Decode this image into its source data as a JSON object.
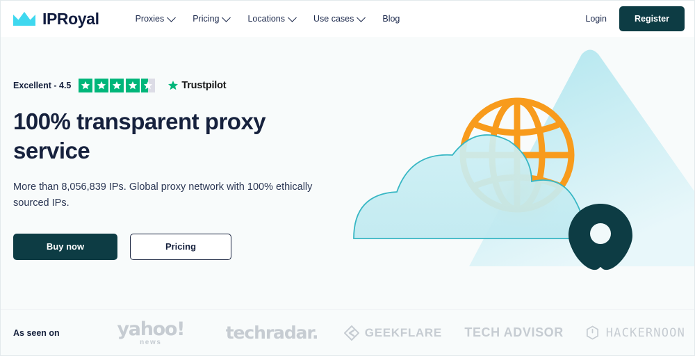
{
  "brand": {
    "name": "IPRoyal",
    "logo_icon": "crown-icon",
    "logo_color": "#3fd8ef",
    "text_color": "#111c3f"
  },
  "nav": {
    "items": [
      {
        "label": "Proxies",
        "has_dropdown": true,
        "icon": "chevron-down-icon"
      },
      {
        "label": "Pricing",
        "has_dropdown": true,
        "icon": "chevron-down-icon"
      },
      {
        "label": "Locations",
        "has_dropdown": true,
        "icon": "chevron-down-icon"
      },
      {
        "label": "Use cases",
        "has_dropdown": true,
        "icon": "chevron-down-icon"
      },
      {
        "label": "Blog",
        "has_dropdown": false,
        "icon": ""
      }
    ],
    "login_label": "Login",
    "register_label": "Register",
    "register_bg": "#0d3c44",
    "register_text_color": "#ffffff"
  },
  "hero": {
    "rating": {
      "text": "Excellent - 4.5",
      "score": "4.5",
      "stars_total": 5,
      "stars_filled": 4,
      "stars_half": 1,
      "star_color": "#00b67a",
      "star_empty_color": "#dcdce6",
      "provider": "Trustpilot",
      "provider_icon": "trustpilot-star-icon"
    },
    "headline": "100% transparent proxy service",
    "subhead": "More than 8,056,839 IPs. Global proxy network with 100% ethically sourced IPs.",
    "ip_count": "8,056,839",
    "primary_cta": "Buy now",
    "secondary_cta": "Pricing",
    "illustration": {
      "mountain_icon": "mountain-shape",
      "mountain_color": "#bfeaf0",
      "globe_icon": "globe-icon",
      "globe_color": "#f89b1c",
      "cloud_icon": "cloud-icon",
      "cloud_fill": "#c7eef3",
      "cloud_stroke": "#38b7c4",
      "pin_icon": "map-pin-icon",
      "pin_color": "#0d3c44"
    }
  },
  "press": {
    "label": "As seen on",
    "logos": [
      {
        "name": "yahoo-news-logo",
        "word": "yahoo!",
        "sub": "news"
      },
      {
        "name": "techradar-logo",
        "word": "techradar.",
        "sub": ""
      },
      {
        "name": "geekflare-logo",
        "word": "GEEKFLARE",
        "sub": ""
      },
      {
        "name": "tech-advisor-logo",
        "word": "TECH ADVISOR",
        "sub": ""
      },
      {
        "name": "hackernoon-logo",
        "word": "HACKERNOON",
        "sub": ""
      }
    ],
    "logo_color": "#c6ccd2"
  },
  "theme": {
    "page_bg": "#f8fbfb",
    "navbar_bg": "#ffffff",
    "text_dark": "#16213d",
    "accent_teal": "#0d3c44",
    "accent_cyan": "#3fd8ef",
    "accent_orange": "#f89b1c"
  }
}
